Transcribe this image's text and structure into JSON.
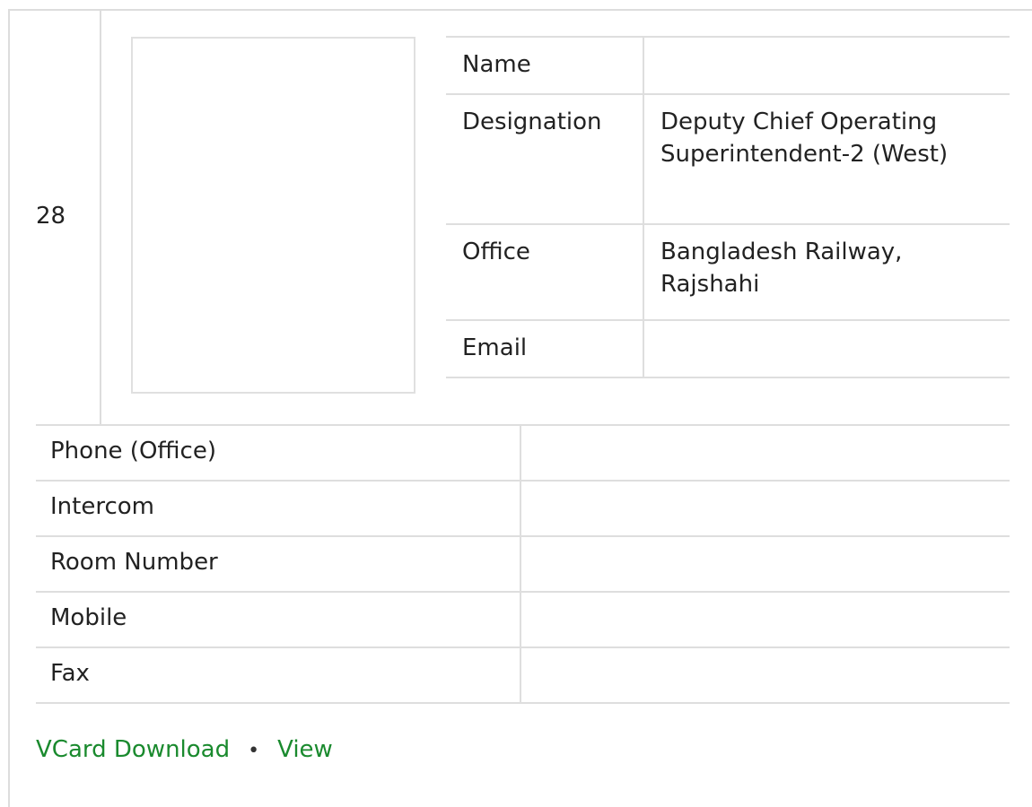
{
  "entry": {
    "serial": "28",
    "info_rows": [
      {
        "label": "Name",
        "value": ""
      },
      {
        "label": "Designation",
        "value": "Deputy Chief Operating Superintendent-2 (West)"
      },
      {
        "label": "Office",
        "value": "Bangladesh Railway, Rajshahi"
      },
      {
        "label": "Email",
        "value": ""
      }
    ],
    "contact_rows": [
      {
        "label": "Phone (Office)",
        "value": ""
      },
      {
        "label": "Intercom",
        "value": ""
      },
      {
        "label": "Room Number",
        "value": ""
      },
      {
        "label": "Mobile",
        "value": ""
      },
      {
        "label": "Fax",
        "value": ""
      }
    ],
    "links": {
      "vcard": "VCard Download",
      "separator": "•",
      "view": "View"
    }
  },
  "colors": {
    "link": "#1a8a2e",
    "border": "#dedede"
  }
}
